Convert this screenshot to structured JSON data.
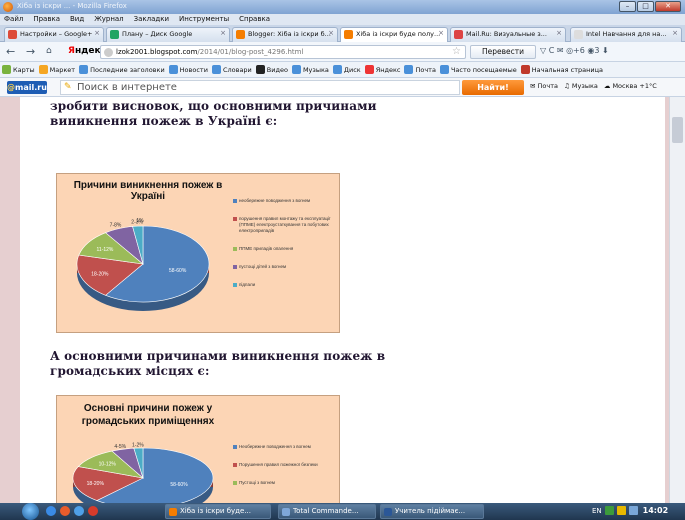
{
  "window": {
    "title": "Хіба із іскри ... - Mozilla Firefox"
  },
  "menu": [
    "Файл",
    "Правка",
    "Вид",
    "Журнал",
    "Закладки",
    "Инструменты",
    "Справка"
  ],
  "tabs": [
    {
      "label": "Настройки – Google+",
      "color": "#dd4b39"
    },
    {
      "label": "Плану – Диск Google",
      "color": "#1fa463"
    },
    {
      "label": "Blogger: Хіба із іскри б...",
      "color": "#f57d00"
    },
    {
      "label": "Хіба із іскри буде полу...",
      "color": "#f57d00",
      "active": true
    },
    {
      "label": "Mail.Ru: Визуальные з...",
      "color": "#d44"
    },
    {
      "label": "Intel Навчання для на...",
      "color": "#ddd"
    }
  ],
  "nav": {
    "back": "←",
    "forward": "→",
    "yandex": {
      "y": "Я",
      "rest": "ндекс"
    },
    "url_host": "lzok2001.blogspot.com",
    "url_path": "/2014/01/blog-post_4296.html",
    "translate": "Перевести",
    "tools": "▽ C  ✉ ◎+6  ◉3  ⬇"
  },
  "bookmarks": [
    {
      "label": "Карты",
      "color": "#7ab33e"
    },
    {
      "label": "Маркет",
      "color": "#f5a623"
    },
    {
      "label": "Последние заголовки",
      "color": "#4a90d9"
    },
    {
      "label": "Новости",
      "color": "#4a90d9"
    },
    {
      "label": "Словари",
      "color": "#4a90d9"
    },
    {
      "label": "Видео",
      "color": "#222"
    },
    {
      "label": "Музыка",
      "color": "#4a90d9"
    },
    {
      "label": "Диск",
      "color": "#4a90d9"
    },
    {
      "label": "Яндекс",
      "color": "#e33"
    },
    {
      "label": "Почта",
      "color": "#4a90d9"
    },
    {
      "label": "Часто посещаемые",
      "color": "#4a90d9"
    },
    {
      "label": "Начальная страница",
      "color": "#c0392b"
    }
  ],
  "mailbar": {
    "logo_at": "@",
    "logo_text": "mail.ru",
    "search_placeholder": "Поиск в интернете",
    "find_button": "Найти!",
    "mail_link": "Почта",
    "music_link": "Музыка",
    "weather": "Москва +1°С"
  },
  "article": {
    "para1": "зробити висновок, що основними причинами виникнення пожеж в Україні є:",
    "para2": "А основними причинами виникнення пожеж в громадських місцях є:"
  },
  "chart_data": [
    {
      "type": "pie",
      "title": "Причини виникнення пожеж в Україні",
      "categories": [
        "необережне поводження з вогнем",
        "порушення правил монтажу та експлуатації (ППМЕ) електроустаткування та побутових електроприладів",
        "ППМЕ приладів опалення",
        "пустощі дітей з вогнем",
        "підпали"
      ],
      "values": [
        59,
        19,
        11.5,
        7,
        2.5
      ],
      "value_labels": [
        "58-60%",
        "18-20%",
        "11-12%",
        "7-8%",
        "2-3%"
      ],
      "extra_label": "1%",
      "colors": [
        "#4f81bd",
        "#c0504d",
        "#9bbb59",
        "#8064a2",
        "#4bacc6"
      ],
      "legend": "right"
    },
    {
      "type": "pie",
      "title": "Основні причини пожеж у громадських приміщеннях",
      "categories": [
        "Необережне поводження з вогнем",
        "Порушення правил пожежної безпеки",
        "Пустощі з вогнем"
      ],
      "values": [
        59,
        19,
        11,
        5,
        2
      ],
      "value_labels": [
        "58-60%",
        "18-20%",
        "10-12%",
        "4-5%",
        "1-2%"
      ],
      "colors": [
        "#4f81bd",
        "#c0504d",
        "#9bbb59",
        "#8064a2",
        "#4bacc6"
      ],
      "legend": "right"
    }
  ],
  "taskbar": {
    "items": [
      {
        "label": "Хіба із іскри буде...",
        "color": "#f57d00"
      },
      {
        "label": "Total Commande...",
        "color": "#7fa7d8"
      },
      {
        "label": "Учитель підіймає...",
        "color": "#2b5797"
      }
    ],
    "lang": "EN",
    "clock": "14:02"
  }
}
